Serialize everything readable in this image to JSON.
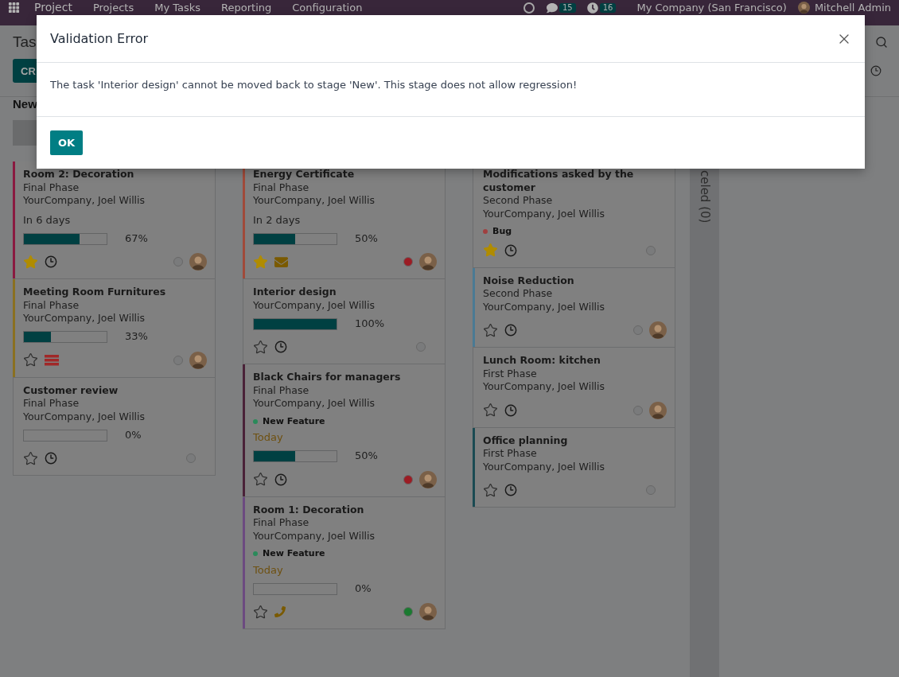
{
  "navbar": {
    "app": "Project",
    "menu": [
      "Projects",
      "My Tasks",
      "Reporting",
      "Configuration"
    ],
    "messages_count": "15",
    "activities_count": "16",
    "company": "My Company (San Francisco)",
    "user": "Mitchell Admin"
  },
  "control_panel": {
    "title": "Tas",
    "create_button": "CR"
  },
  "columns": [
    {
      "header": "New",
      "cards": [
        {
          "title": "Room 2: Decoration",
          "phase": "Final Phase",
          "company": "YourCompany, Joel Willis",
          "date": {
            "text": "In 6 days",
            "today": false
          },
          "progress": {
            "level": 0.67,
            "label": "67%"
          },
          "starred": true,
          "activity": {
            "kind": "clock"
          },
          "status": {
            "color": "#7a7b7c"
          },
          "avatar": true,
          "color": "#8a1a40"
        },
        {
          "title": "Meeting Room Furnitures",
          "phase": "Final Phase",
          "company": "YourCompany, Joel Willis",
          "progress": {
            "level": 0.33,
            "label": "33%"
          },
          "starred": false,
          "activity": {
            "kind": "todo"
          },
          "status": {
            "color": "#7a7b7c"
          },
          "avatar": true,
          "color": "#8a7020"
        },
        {
          "title": "Customer review",
          "phase": "Final Phase",
          "company": "YourCompany, Joel Willis",
          "progress": {
            "level": 0,
            "label": "0%"
          },
          "starred": false,
          "activity": {
            "kind": "clock"
          },
          "status": {
            "color": "#7a7b7c"
          },
          "avatar": false
        }
      ]
    },
    {
      "cards": [
        {
          "title": "Energy Certificate",
          "phase": "Final Phase",
          "company": "YourCompany, Joel Willis",
          "date": {
            "text": "In 2 days",
            "today": false
          },
          "progress": {
            "level": 0.5,
            "label": "50%"
          },
          "starred": true,
          "activity": {
            "kind": "email"
          },
          "status": {
            "color": "#9c1c24"
          },
          "avatar": true,
          "color": "#a04a3a"
        },
        {
          "title": "Interior design",
          "company": "YourCompany, Joel Willis",
          "progress": {
            "level": 1,
            "label": "100%"
          },
          "starred": false,
          "activity": {
            "kind": "clock"
          },
          "status": {
            "color": "#7a7b7c"
          },
          "avatar": false
        },
        {
          "title": "Black Chairs for managers",
          "phase": "Final Phase",
          "company": "YourCompany, Joel Willis",
          "tag": {
            "label": "New Feature",
            "color": "#2a8a5a"
          },
          "date": {
            "text": "Today",
            "today": true
          },
          "progress": {
            "level": 0.5,
            "label": "50%"
          },
          "starred": false,
          "activity": {
            "kind": "clock"
          },
          "status": {
            "color": "#9c1c24"
          },
          "avatar": true,
          "color": "#4a2238"
        },
        {
          "title": "Room 1: Decoration",
          "phase": "Final Phase",
          "company": "YourCompany, Joel Willis",
          "tag": {
            "label": "New Feature",
            "color": "#2a8a5a"
          },
          "date": {
            "text": "Today",
            "today": true
          },
          "progress": {
            "level": 0,
            "label": "0%"
          },
          "starred": false,
          "activity": {
            "kind": "phone"
          },
          "status": {
            "color": "#1a7a30"
          },
          "avatar": true,
          "color": "#6c4a80"
        }
      ]
    },
    {
      "cards": [
        {
          "title": "Modifications asked by the customer",
          "phase": "Second Phase",
          "company": "YourCompany, Joel Willis",
          "tag": {
            "label": "Bug",
            "color": "#a04040"
          },
          "starred": true,
          "activity": {
            "kind": "clock"
          },
          "status": {
            "color": "#7a7b7c"
          },
          "avatar": false
        },
        {
          "title": "Noise Reduction",
          "phase": "Second Phase",
          "company": "YourCompany, Joel Willis",
          "starred": false,
          "activity": {
            "kind": "clock"
          },
          "status": {
            "color": "#7a7b7c"
          },
          "avatar": true,
          "color": "#4a7a94"
        },
        {
          "title": "Lunch Room: kitchen",
          "phase": "First Phase",
          "company": "YourCompany, Joel Willis",
          "starred": false,
          "activity": {
            "kind": "clock"
          },
          "status": {
            "color": "#7a7b7c"
          },
          "avatar": true
        },
        {
          "title": "Office planning",
          "phase": "First Phase",
          "company": "YourCompany, Joel Willis",
          "starred": false,
          "activity": {
            "kind": "clock"
          },
          "status": {
            "color": "#7a7b7c"
          },
          "avatar": false,
          "color": "#1a4a52"
        }
      ]
    }
  ],
  "folded_column": {
    "label": "celed (0)"
  },
  "dialog": {
    "title": "Validation Error",
    "message": "The task 'Interior design' cannot be moved back to stage 'New'. This stage does not allow regression!",
    "ok_button": "OK"
  }
}
